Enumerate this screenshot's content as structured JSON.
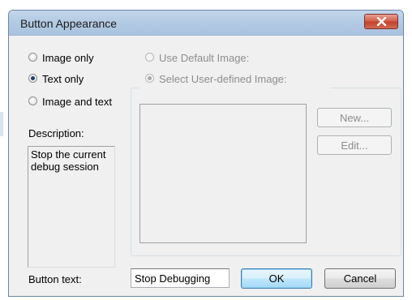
{
  "dialog": {
    "title": "Button Appearance"
  },
  "appearance_options": [
    {
      "label": "Image only",
      "checked": false
    },
    {
      "label": "Text only",
      "checked": true
    },
    {
      "label": "Image and text",
      "checked": false
    }
  ],
  "image_options": [
    {
      "label": "Use Default Image:",
      "checked": false,
      "disabled": true
    },
    {
      "label": "Select User-defined Image:",
      "checked": true,
      "disabled": true
    }
  ],
  "description": {
    "label": "Description:",
    "text": "Stop the current debug session"
  },
  "image_buttons": {
    "new_label": "New...",
    "edit_label": "Edit..."
  },
  "button_text": {
    "label": "Button text:",
    "value": "Stop Debugging"
  },
  "actions": {
    "ok_label": "OK",
    "cancel_label": "Cancel"
  },
  "colors": {
    "titlebar": "#b4cbe4",
    "close_button": "#c2432c",
    "dialog_bg": "#f0f0f0",
    "default_button": "#bee6fd"
  }
}
